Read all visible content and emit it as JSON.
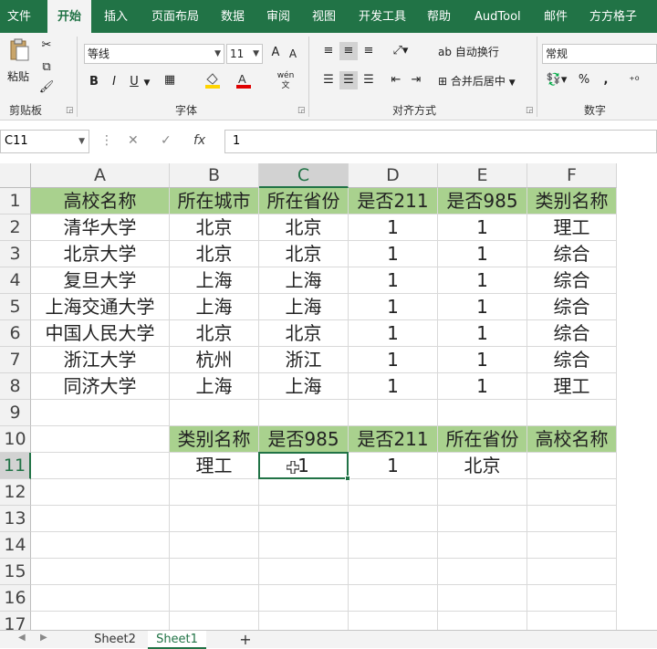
{
  "menu": {
    "items": [
      "文件",
      "开始",
      "插入",
      "页面布局",
      "数据",
      "审阅",
      "视图",
      "开发工具",
      "帮助",
      "AudTool",
      "邮件",
      "方方格子"
    ],
    "active_index": 1
  },
  "ribbon": {
    "paste_label": "粘贴",
    "clipboard_label": "剪贴板",
    "font_name": "等线",
    "font_size": "11",
    "font_group_label": "字体",
    "bold": "B",
    "italic": "I",
    "underline": "U",
    "grow_font": "A",
    "shrink_font": "A",
    "wen_label": "wén 文",
    "wrap_text_label": "自动换行",
    "merge_center_label": "合并后居中",
    "align_group_label": "对齐方式",
    "number_format": "常规",
    "number_group_label": "数字",
    "percent": "%",
    "comma": ","
  },
  "formula_bar": {
    "name_box": "C11",
    "fx_label": "fx",
    "value": "1"
  },
  "grid": {
    "columns": [
      "A",
      "B",
      "C",
      "D",
      "E",
      "F"
    ],
    "selected_column": "C",
    "rows": [
      "1",
      "2",
      "3",
      "4",
      "5",
      "6",
      "7",
      "8",
      "9",
      "10",
      "11",
      "12",
      "13",
      "14",
      "15",
      "16",
      "17"
    ],
    "selected_row": "11",
    "table_header": [
      "高校名称",
      "所在城市",
      "所在省份",
      "是否211",
      "是否985",
      "类别名称"
    ],
    "table_rows": [
      [
        "清华大学",
        "北京",
        "北京",
        "1",
        "1",
        "理工"
      ],
      [
        "北京大学",
        "北京",
        "北京",
        "1",
        "1",
        "综合"
      ],
      [
        "复旦大学",
        "上海",
        "上海",
        "1",
        "1",
        "综合"
      ],
      [
        "上海交通大学",
        "上海",
        "上海",
        "1",
        "1",
        "综合"
      ],
      [
        "中国人民大学",
        "北京",
        "北京",
        "1",
        "1",
        "综合"
      ],
      [
        "浙江大学",
        "杭州",
        "浙江",
        "1",
        "1",
        "综合"
      ],
      [
        "同济大学",
        "上海",
        "上海",
        "1",
        "1",
        "理工"
      ]
    ],
    "lookup_header": [
      "类别名称",
      "是否985",
      "是否211",
      "所在省份",
      "高校名称"
    ],
    "lookup_values": [
      "理工",
      "1",
      "1",
      "北京",
      ""
    ]
  },
  "sheets": {
    "tabs": [
      "Sheet2",
      "Sheet1"
    ],
    "active": "Sheet1",
    "add_label": "+"
  },
  "colors": {
    "accent": "#217346",
    "header_fill": "#a9d18e"
  }
}
